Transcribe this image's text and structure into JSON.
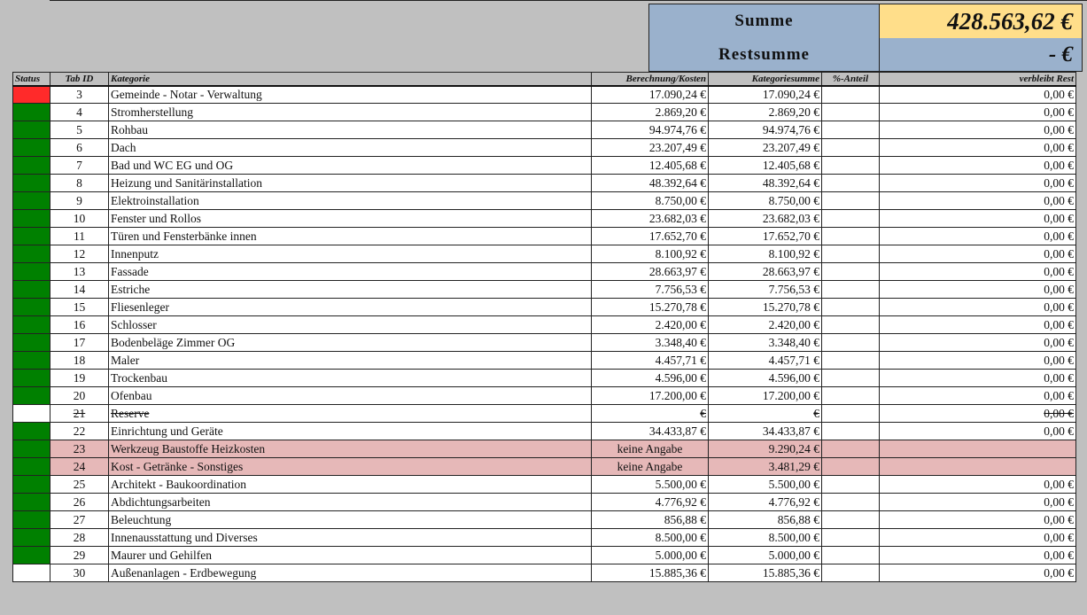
{
  "summary": {
    "summe_label": "Summe",
    "summe_value": "428.563,62 €",
    "restsumme_label": "Restsumme",
    "restsumme_value": "- €"
  },
  "headers": {
    "status": "Status",
    "tab_id": "Tab ID",
    "kategorie": "Kategorie",
    "berechnung": "Berechnung/Kosten",
    "kategoriesumme": "Kategoriesumme",
    "anteil": "%-Anteil",
    "rest": "verbleibt Rest"
  },
  "colors": {
    "status_green": "#008000",
    "status_red": "#ff2a2a",
    "highlight_pink": "#e6b8b8",
    "summary_blue": "#9ab1cc",
    "summary_yellow": "#ffde8a"
  },
  "rows": [
    {
      "status": "red",
      "id": "3",
      "kategorie": "Gemeinde - Notar - Verwaltung",
      "berechnung": "17.090,24 €",
      "ksum": "17.090,24 €",
      "anteil": "",
      "rest": "0,00 €",
      "style": ""
    },
    {
      "status": "green",
      "id": "4",
      "kategorie": "Stromherstellung",
      "berechnung": "2.869,20 €",
      "ksum": "2.869,20 €",
      "anteil": "",
      "rest": "0,00 €",
      "style": ""
    },
    {
      "status": "green",
      "id": "5",
      "kategorie": "Rohbau",
      "berechnung": "94.974,76 €",
      "ksum": "94.974,76 €",
      "anteil": "",
      "rest": "0,00 €",
      "style": ""
    },
    {
      "status": "green",
      "id": "6",
      "kategorie": "Dach",
      "berechnung": "23.207,49 €",
      "ksum": "23.207,49 €",
      "anteil": "",
      "rest": "0,00 €",
      "style": ""
    },
    {
      "status": "green",
      "id": "7",
      "kategorie": "Bad und WC EG und OG",
      "berechnung": "12.405,68 €",
      "ksum": "12.405,68 €",
      "anteil": "",
      "rest": "0,00 €",
      "style": ""
    },
    {
      "status": "green",
      "id": "8",
      "kategorie": "Heizung und Sanitärinstallation",
      "berechnung": "48.392,64 €",
      "ksum": "48.392,64 €",
      "anteil": "",
      "rest": "0,00 €",
      "style": ""
    },
    {
      "status": "green",
      "id": "9",
      "kategorie": "Elektroinstallation",
      "berechnung": "8.750,00 €",
      "ksum": "8.750,00 €",
      "anteil": "",
      "rest": "0,00 €",
      "style": ""
    },
    {
      "status": "green",
      "id": "10",
      "kategorie": "Fenster und Rollos",
      "berechnung": "23.682,03 €",
      "ksum": "23.682,03 €",
      "anteil": "",
      "rest": "0,00 €",
      "style": ""
    },
    {
      "status": "green",
      "id": "11",
      "kategorie": "Türen und Fensterbänke innen",
      "berechnung": "17.652,70 €",
      "ksum": "17.652,70 €",
      "anteil": "",
      "rest": "0,00 €",
      "style": ""
    },
    {
      "status": "green",
      "id": "12",
      "kategorie": "Innenputz",
      "berechnung": "8.100,92 €",
      "ksum": "8.100,92 €",
      "anteil": "",
      "rest": "0,00 €",
      "style": ""
    },
    {
      "status": "green",
      "id": "13",
      "kategorie": "Fassade",
      "berechnung": "28.663,97 €",
      "ksum": "28.663,97 €",
      "anteil": "",
      "rest": "0,00 €",
      "style": ""
    },
    {
      "status": "green",
      "id": "14",
      "kategorie": "Estriche",
      "berechnung": "7.756,53 €",
      "ksum": "7.756,53 €",
      "anteil": "",
      "rest": "0,00 €",
      "style": ""
    },
    {
      "status": "green",
      "id": "15",
      "kategorie": "Fliesenleger",
      "berechnung": "15.270,78 €",
      "ksum": "15.270,78 €",
      "anteil": "",
      "rest": "0,00 €",
      "style": ""
    },
    {
      "status": "green",
      "id": "16",
      "kategorie": "Schlosser",
      "berechnung": "2.420,00 €",
      "ksum": "2.420,00 €",
      "anteil": "",
      "rest": "0,00 €",
      "style": ""
    },
    {
      "status": "green",
      "id": "17",
      "kategorie": "Bodenbeläge Zimmer OG",
      "berechnung": "3.348,40 €",
      "ksum": "3.348,40 €",
      "anteil": "",
      "rest": "0,00 €",
      "style": ""
    },
    {
      "status": "green",
      "id": "18",
      "kategorie": "Maler",
      "berechnung": "4.457,71 €",
      "ksum": "4.457,71 €",
      "anteil": "",
      "rest": "0,00 €",
      "style": ""
    },
    {
      "status": "green",
      "id": "19",
      "kategorie": "Trockenbau",
      "berechnung": "4.596,00 €",
      "ksum": "4.596,00 €",
      "anteil": "",
      "rest": "0,00 €",
      "style": ""
    },
    {
      "status": "green",
      "id": "20",
      "kategorie": "Ofenbau",
      "berechnung": "17.200,00 €",
      "ksum": "17.200,00 €",
      "anteil": "",
      "rest": "0,00 €",
      "style": ""
    },
    {
      "status": "empty",
      "id": "21",
      "kategorie": "Reserve",
      "berechnung": "€",
      "ksum": "€",
      "anteil": "",
      "rest": "0,00 €",
      "style": "strike"
    },
    {
      "status": "green",
      "id": "22",
      "kategorie": "Einrichtung und Geräte",
      "berechnung": "34.433,87 €",
      "ksum": "34.433,87 €",
      "anteil": "",
      "rest": "0,00 €",
      "style": ""
    },
    {
      "status": "green",
      "id": "23",
      "kategorie": "Werkzeug Baustoffe Heizkosten",
      "berechnung": "keine Angabe",
      "ksum": "9.290,24 €",
      "anteil": "",
      "rest": "",
      "style": "pink"
    },
    {
      "status": "green",
      "id": "24",
      "kategorie": "Kost - Getränke - Sonstiges",
      "berechnung": "keine Angabe",
      "ksum": "3.481,29 €",
      "anteil": "",
      "rest": "",
      "style": "pink"
    },
    {
      "status": "green",
      "id": "25",
      "kategorie": "Architekt - Baukoordination",
      "berechnung": "5.500,00 €",
      "ksum": "5.500,00 €",
      "anteil": "",
      "rest": "0,00 €",
      "style": ""
    },
    {
      "status": "green",
      "id": "26",
      "kategorie": "Abdichtungsarbeiten",
      "berechnung": "4.776,92 €",
      "ksum": "4.776,92 €",
      "anteil": "",
      "rest": "0,00 €",
      "style": ""
    },
    {
      "status": "green",
      "id": "27",
      "kategorie": "Beleuchtung",
      "berechnung": "856,88 €",
      "ksum": "856,88 €",
      "anteil": "",
      "rest": "0,00 €",
      "style": ""
    },
    {
      "status": "green",
      "id": "28",
      "kategorie": "Innenausstattung und Diverses",
      "berechnung": "8.500,00 €",
      "ksum": "8.500,00 €",
      "anteil": "",
      "rest": "0,00 €",
      "style": ""
    },
    {
      "status": "green",
      "id": "29",
      "kategorie": "Maurer und Gehilfen",
      "berechnung": "5.000,00 €",
      "ksum": "5.000,00 €",
      "anteil": "",
      "rest": "0,00 €",
      "style": ""
    },
    {
      "status": "empty",
      "id": "30",
      "kategorie": "Außenanlagen - Erdbewegung",
      "berechnung": "15.885,36 €",
      "ksum": "15.885,36 €",
      "anteil": "",
      "rest": "0,00 €",
      "style": ""
    }
  ]
}
